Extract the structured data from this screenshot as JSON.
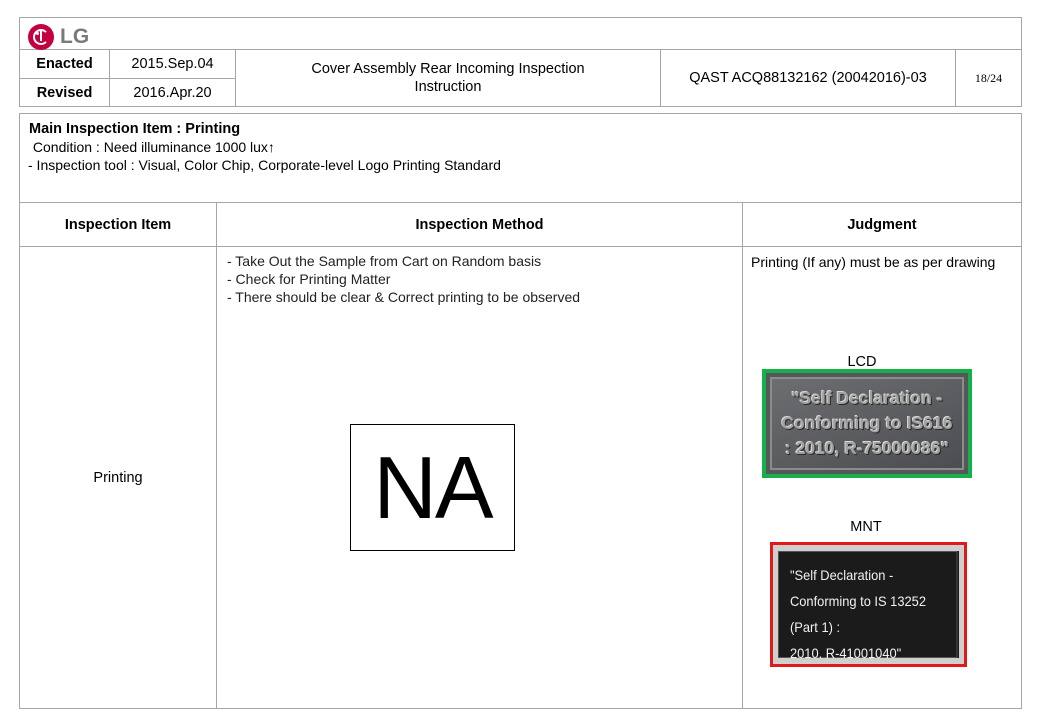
{
  "header": {
    "logo_text": "LG",
    "enacted_label": "Enacted",
    "enacted_date": "2015.Sep.04",
    "revised_label": "Revised",
    "revised_date": "2016.Apr.20",
    "title_line1": "Cover Assembly Rear Incoming Inspection",
    "title_line2": "Instruction",
    "doc_code": "QAST ACQ88132162 (20042016)-03",
    "page": "18/24"
  },
  "info": {
    "main_item": "Main Inspection Item : Printing",
    "condition": " Condition : Need illuminance 1000 lux↑",
    "tool": "- Inspection tool : Visual, Color Chip, Corporate-level Logo Printing Standard"
  },
  "table": {
    "headers": [
      "Inspection Item",
      "Inspection Method",
      "Judgment"
    ],
    "item": "Printing",
    "method_lines": [
      "- Take Out the Sample from Cart on Random basis",
      "- Check for Printing Matter",
      "- There should be clear & Correct printing to be observed"
    ],
    "na_text": "NA",
    "judgment_text": "Printing (If any) must be as per drawing",
    "lcd_label": "LCD",
    "lcd_plate_lines": [
      "\"Self Declaration -",
      "Conforming to IS616",
      ": 2010, R-75000086\""
    ],
    "mnt_label": "MNT",
    "mnt_plate_lines": [
      "\"Self Declaration -",
      "Conforming to IS 13252 (Part 1) :",
      "2010, R-41001040\""
    ]
  },
  "colors": {
    "logo": "#c5003e",
    "lcd_border": "#15b04a",
    "mnt_border": "#e01a1a",
    "grid": "#a6a6a6"
  }
}
